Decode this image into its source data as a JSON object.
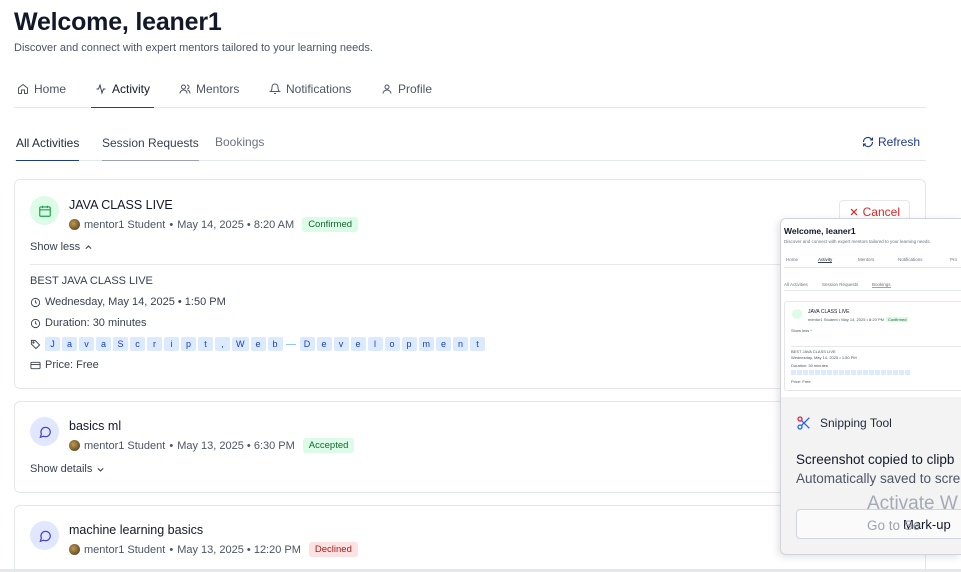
{
  "header": {
    "title": "Welcome, leaner1",
    "subtitle": "Discover and connect with expert mentors tailored to your learning needs."
  },
  "main_tabs": [
    {
      "label": "Home",
      "icon": "home-icon"
    },
    {
      "label": "Activity",
      "icon": "activity-icon",
      "active": true
    },
    {
      "label": "Mentors",
      "icon": "users-icon"
    },
    {
      "label": "Notifications",
      "icon": "bell-icon"
    },
    {
      "label": "Profile",
      "icon": "user-icon"
    }
  ],
  "sub_tabs": [
    {
      "label": "All Activities",
      "active": true
    },
    {
      "label": "Session Requests"
    },
    {
      "label": "Bookings"
    }
  ],
  "refresh_label": "Refresh",
  "activities": [
    {
      "title": "JAVA CLASS LIVE",
      "mentor": "mentor1 Student",
      "datetime": "May 14, 2025 • 8:20 AM",
      "status": "Confirmed",
      "toggle": "Show less",
      "cancel_label": "Cancel",
      "details": {
        "heading": "BEST JAVA CLASS LIVE",
        "session_time": "Wednesday, May 14, 2025 • 1:50 PM",
        "duration": "Duration: 30 minutes",
        "tags": [
          "J",
          "a",
          "v",
          "a",
          "S",
          "c",
          "r",
          "i",
          "p",
          "t",
          ",",
          "W",
          "e",
          "b",
          "-",
          "D",
          "e",
          "v",
          "e",
          "l",
          "o",
          "p",
          "m",
          "e",
          "n",
          "t"
        ],
        "price": "Price: Free"
      }
    },
    {
      "title": "basics ml",
      "mentor": "mentor1 Student",
      "datetime": "May 13, 2025 • 6:30 PM",
      "status": "Accepted",
      "toggle": "Show details"
    },
    {
      "title": "machine learning basics",
      "mentor": "mentor1 Student",
      "datetime": "May 13, 2025 • 12:20 PM",
      "status": "Declined"
    }
  ],
  "snip": {
    "thumb_title": "Welcome, leaner1",
    "thumb_subtitle": "Discover and connect with expert mentors tailored to your learning needs.",
    "thumb_tabs": [
      "Home",
      "Activity",
      "Mentors",
      "Notifications",
      "Pro"
    ],
    "thumb_subtabs": [
      "All Activities",
      "Session Requests",
      "Bookings"
    ],
    "thumb_card_title": "JAVA CLASS LIVE",
    "thumb_card_meta": "mentor1 Student • May 14, 2025 • 8:20 PM",
    "thumb_card_status": "Confirmed",
    "thumb_toggle": "Show less ^",
    "thumb_heading": "BEST JAVA CLASS LIVE",
    "thumb_time": "Wednesday, May 14, 2025 • 1:50 PM",
    "thumb_duration": "Duration: 30 minutes",
    "thumb_price": "Price: Free",
    "app_name": "Snipping Tool",
    "message1": "Screenshot copied to clipb",
    "message2": "Automatically saved to scre",
    "markup_label": "Mark-up"
  },
  "watermark": {
    "line1": "Activate W",
    "line2": "Go to Se"
  }
}
